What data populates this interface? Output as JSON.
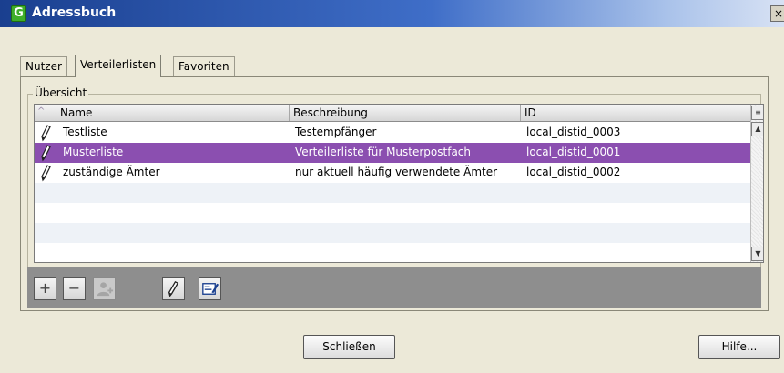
{
  "window": {
    "title": "Adressbuch",
    "icon_letter": "G",
    "close_glyph": "×"
  },
  "tabs": [
    {
      "label": "Nutzer",
      "active": false
    },
    {
      "label": "Verteilerlisten",
      "active": true
    },
    {
      "label": "Favoriten",
      "active": false
    }
  ],
  "group": {
    "label": "Übersicht"
  },
  "table": {
    "columns": [
      "Name",
      "Beschreibung",
      "ID"
    ],
    "sort_indicator": "^",
    "rows": [
      {
        "name": "Testliste",
        "description": "Testempfänger",
        "id": "local_distid_0003",
        "selected": false
      },
      {
        "name": "Musterliste",
        "description": "Verteilerliste für Musterpostfach",
        "id": "local_distid_0001",
        "selected": true
      },
      {
        "name": "zuständige Ämter",
        "description": "nur aktuell häufig verwendete Ämter",
        "id": "local_distid_0002",
        "selected": false
      }
    ]
  },
  "toolbar": {
    "add_glyph": "+",
    "remove_glyph": "−"
  },
  "buttons": {
    "close_label": "Schließen",
    "help_label": "Hilfe..."
  },
  "colors": {
    "selection": "#8b4fb0",
    "title_bar": "#1a3f8f",
    "background": "#ece9d8"
  }
}
